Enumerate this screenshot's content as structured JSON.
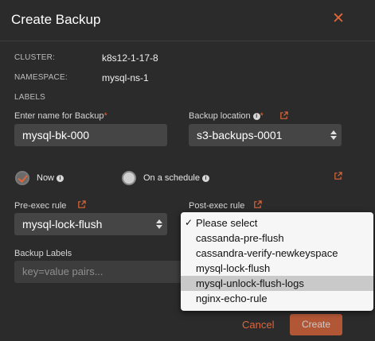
{
  "dialog": {
    "title": "Create Backup",
    "close_glyph": "✕"
  },
  "meta": {
    "cluster_label": "CLUSTER:",
    "cluster_value": "k8s12-1-17-8",
    "namespace_label": "NAMESPACE:",
    "namespace_value": "mysql-ns-1",
    "labels_label": "LABELS"
  },
  "backup_name": {
    "label": "Enter name for Backup",
    "required_mark": "*",
    "value": "mysql-bk-000"
  },
  "backup_location": {
    "label": "Backup location",
    "required_mark": "*",
    "value": "s3-backups-0001"
  },
  "schedule": {
    "now_label": "Now",
    "schedule_label": "On a schedule",
    "selected": "now"
  },
  "pre_exec": {
    "label": "Pre-exec rule",
    "value": "mysql-lock-flush"
  },
  "post_exec": {
    "label": "Post-exec rule",
    "options": [
      "Please select",
      "cassanda-pre-flush",
      "cassandra-verify-newkeyspace",
      "mysql-lock-flush",
      "mysql-unlock-flush-logs",
      "nginx-echo-rule"
    ],
    "selected_index": 0,
    "highlighted_index": 4
  },
  "backup_labels": {
    "label": "Backup Labels",
    "placeholder": "key=value pairs..."
  },
  "footer": {
    "cancel_label": "Cancel",
    "create_label": "Create"
  },
  "colors": {
    "accent": "#e0663a",
    "background": "#2b2b2b",
    "input_bg": "#454545"
  },
  "icons": {
    "external": "external-link-icon",
    "info": "info-icon"
  }
}
